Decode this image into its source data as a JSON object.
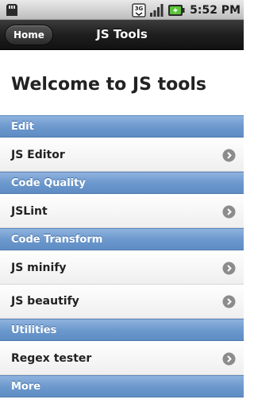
{
  "status_bar": {
    "time": "5:52 PM",
    "network_label": "3G",
    "icons": [
      "sd-card-icon",
      "network-3g-icon",
      "signal-icon",
      "battery-icon"
    ]
  },
  "header": {
    "home_label": "Home",
    "title": "JS Tools"
  },
  "welcome": "Welcome to JS tools",
  "sections": [
    {
      "title": "Edit",
      "items": [
        {
          "label": "JS Editor"
        }
      ]
    },
    {
      "title": "Code Quality",
      "items": [
        {
          "label": "JSLint"
        }
      ]
    },
    {
      "title": "Code Transform",
      "items": [
        {
          "label": "JS minify"
        },
        {
          "label": "JS beautify"
        }
      ]
    },
    {
      "title": "Utilities",
      "items": [
        {
          "label": "Regex tester"
        }
      ]
    },
    {
      "title": "More",
      "items": []
    }
  ],
  "colors": {
    "header_bg": "#1f1f1f",
    "divider_bg": "#6a97cc",
    "item_bg": "#f7f7f7",
    "chevron": "#8c8c8c"
  }
}
